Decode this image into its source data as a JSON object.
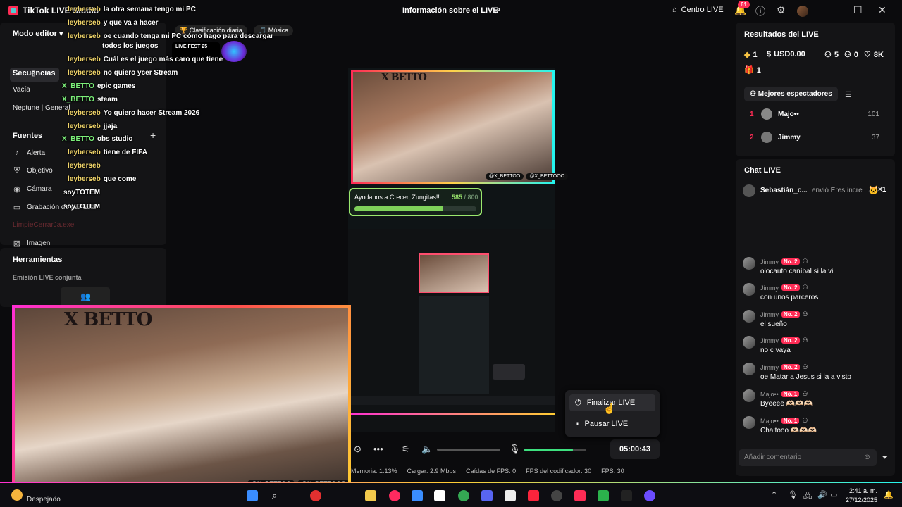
{
  "app": {
    "title": "TikTok LIVE Studio",
    "page_title": "Información sobre el LIVE",
    "centro_live": "Centro LIVE",
    "notifications": "61"
  },
  "left": {
    "mode_label": "Modo editor",
    "sequences_title": "Secuencias",
    "sequences": [
      "Vacía",
      "Neptune | General"
    ],
    "sources_title": "Fuentes",
    "sources": [
      {
        "label": "Alerta",
        "icon": "bell-icon"
      },
      {
        "label": "Objetivo",
        "icon": "shield-icon"
      },
      {
        "label": "Cámara",
        "icon": "camera-icon"
      },
      {
        "label": "Grabación de pantalla",
        "icon": "monitor-icon"
      },
      {
        "label": "LimpieCerrarJa.exe",
        "icon": "app-icon"
      },
      {
        "label": "Imagen",
        "icon": "image-icon"
      }
    ],
    "tools_title": "Herramientas",
    "tools_sub": "Emisión LIVE conjunta"
  },
  "overlay_pills": [
    "Clasificación diaria",
    "Música"
  ],
  "overlay_chat": [
    {
      "user": "leyberseb",
      "text": "la otra semana tengo mi PC"
    },
    {
      "user": "leyberseb",
      "text": "y que va a hacer"
    },
    {
      "user": "leyberseb",
      "text": "oe cuando tenga mi PC cómo hago para descargar"
    },
    {
      "user": "",
      "text": "todos los juegos"
    },
    {
      "user": "leyberseb",
      "text": "Cuál es el juego más caro que tiene"
    },
    {
      "user": "leyberseb",
      "text": "no quiero ycer Stream"
    },
    {
      "user": "X_BETTO",
      "text": "epic games"
    },
    {
      "user": "X_BETTO",
      "text": "steam"
    },
    {
      "user": "leyberseb",
      "text": "Yo quiero hacer Stream 2026"
    },
    {
      "user": "leyberseb",
      "text": "jjaja"
    },
    {
      "user": "X_BETTO",
      "text": "obs studio"
    },
    {
      "user": "leyberseb",
      "text": "tiene de FIFA"
    },
    {
      "user": "leyberseb",
      "text": ""
    },
    {
      "user": "leyberseb",
      "text": "que come"
    },
    {
      "user": "soyTOTEM",
      "text": ""
    },
    {
      "user": "soyTOTEM",
      "text": ""
    }
  ],
  "livefest": "LIVE FEST 25",
  "brand": "X BETTO",
  "social_tiktok": "@X_BETTOO",
  "social_ig": "@X_BETTOOO",
  "goal": {
    "text": "Ayudanos a Crecer, Zungitas!!",
    "current": "585",
    "total": "800",
    "fraction": 0.73
  },
  "controls": {
    "timer": "05:00:43",
    "mic_level": 0.78
  },
  "popup": {
    "end": "Finalizar LIVE",
    "pause": "Pausar LIVE"
  },
  "stats": [
    "Memoria: 1.13%",
    "Cargar: 2.9 Mbps",
    "Caídas de FPS: 0",
    "FPS del codificador: 30",
    "FPS: 30"
  ],
  "results": {
    "title": "Resultados del LIVE",
    "diamonds": "1",
    "usd": "USD0.00",
    "viewers": "5",
    "shares": "0",
    "likes": "8K",
    "gifts": "1",
    "top_title": "Mejores espectadores",
    "top": [
      {
        "rank": "1",
        "name": "Majo••",
        "score": "101"
      },
      {
        "rank": "2",
        "name": "Jimmy",
        "score": "37"
      }
    ]
  },
  "chat": {
    "title": "Chat LIVE",
    "gift": {
      "user": "Sebastián_c...",
      "text": "envió Eres incre",
      "count": "×1"
    },
    "messages": [
      {
        "user": "Jimmy",
        "badge": "No. 2",
        "text": "olocauto caníbal si la vi"
      },
      {
        "user": "Jimmy",
        "badge": "No. 2",
        "text": "con unos parceros"
      },
      {
        "user": "Jimmy",
        "badge": "No. 2",
        "text": "el sueño"
      },
      {
        "user": "Jimmy",
        "badge": "No. 2",
        "text": "no c vaya"
      },
      {
        "user": "Jimmy",
        "badge": "No. 2",
        "text": "oe Matar a Jesus si la a visto"
      },
      {
        "user": "Majo••",
        "badge": "No. 1",
        "text": "Byeeee 🫶🏻🫶🏻🫶🏻"
      },
      {
        "user": "Majo••",
        "badge": "No. 1",
        "text": "Chaitooo 🫶🏻🫶🏻🫶🏻"
      }
    ],
    "placeholder": "Añadir comentario"
  },
  "taskbar": {
    "weather": "Despejado",
    "time": "2:41 a. m.",
    "date": "27/12/2025"
  }
}
